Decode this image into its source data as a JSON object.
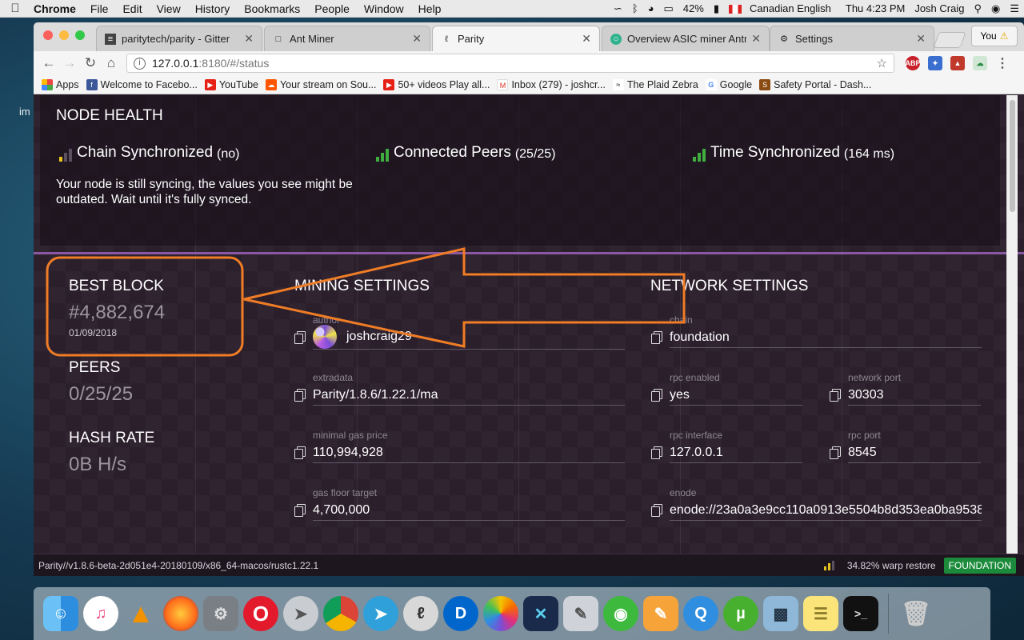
{
  "menubar": {
    "app": "Chrome",
    "items": [
      "File",
      "Edit",
      "View",
      "History",
      "Bookmarks",
      "People",
      "Window",
      "Help"
    ],
    "battery": "42%",
    "input_source": "Canadian English",
    "clock": "Thu 4:23 PM",
    "user": "Josh Craig"
  },
  "desktop_label": "im",
  "browser": {
    "tabs": [
      {
        "title": "paritytech/parity - Gitter",
        "icon": "gitter-icon"
      },
      {
        "title": "Ant Miner",
        "icon": "document-icon"
      },
      {
        "title": "Parity",
        "icon": "parity-icon"
      },
      {
        "title": "Overview ASIC miner Antmi",
        "icon": "overview-icon"
      },
      {
        "title": "Settings",
        "icon": "gear-icon"
      }
    ],
    "profile_button": "You",
    "url_host": "127.0.0.1",
    "url_rest": ":8180/#/status",
    "extensions": [
      "ABP"
    ],
    "bookmarks": [
      "Apps",
      "Welcome to Facebo...",
      "YouTube",
      "Your stream on Sou...",
      "50+ videos Play all...",
      "Inbox (279) - joshcr...",
      "The Plaid Zebra",
      "Google",
      "Safety Portal - Dash..."
    ]
  },
  "node_health": {
    "title": "NODE HEALTH",
    "chain": {
      "label": "Chain Synchronized",
      "detail": "(no)"
    },
    "peers": {
      "label": "Connected Peers",
      "detail": "(25/25)"
    },
    "time": {
      "label": "Time Synchronized",
      "detail": "(164 ms)"
    },
    "message": "Your node is still syncing, the values you see might be outdated. Wait until it's fully synced."
  },
  "stats": {
    "best_block": {
      "title": "BEST BLOCK",
      "value": "#4,882,674",
      "date": "01/09/2018"
    },
    "peers": {
      "title": "PEERS",
      "value": "0/25/25"
    },
    "hash_rate": {
      "title": "HASH RATE",
      "value": "0B H/s"
    }
  },
  "mining": {
    "title": "MINING SETTINGS",
    "author": {
      "label": "author",
      "value": "joshcraig29"
    },
    "extradata": {
      "label": "extradata",
      "value": "Parity/1.8.6/1.22.1/ma"
    },
    "min_gas": {
      "label": "minimal gas price",
      "value": "110,994,928"
    },
    "gas_floor": {
      "label": "gas floor target",
      "value": "4,700,000"
    }
  },
  "network": {
    "title": "NETWORK SETTINGS",
    "chain": {
      "label": "chain",
      "value": "foundation"
    },
    "rpc_enabled": {
      "label": "rpc enabled",
      "value": "yes"
    },
    "network_port": {
      "label": "network port",
      "value": "30303"
    },
    "rpc_interface": {
      "label": "rpc interface",
      "value": "127.0.0.1"
    },
    "rpc_port": {
      "label": "rpc port",
      "value": "8545"
    },
    "enode": {
      "label": "enode",
      "value": "enode://23a0a3e9cc110a0913e5504b8d353ea0ba9538"
    }
  },
  "statusbar": {
    "version": "Parity//v1.8.6-beta-2d051e4-20180109/x86_64-macos/rustc1.22.1",
    "sync": "34.82% warp restore",
    "chain": "FOUNDATION"
  },
  "colors": {
    "accent": "#8a58a0",
    "annotation": "#f07d25",
    "good": "#3fae3f",
    "warn": "#e8c21c",
    "badge": "#1b8a3a"
  },
  "dock": [
    "finder",
    "itunes",
    "vlc",
    "firefox",
    "system-preferences",
    "opera",
    "launchpad",
    "chrome",
    "telegram",
    "parity",
    "digibyte",
    "photos",
    "exodus",
    "script-editor",
    "wechat",
    "pages",
    "quicktime",
    "utorrent",
    "preview",
    "notes",
    "terminal",
    "trash"
  ]
}
